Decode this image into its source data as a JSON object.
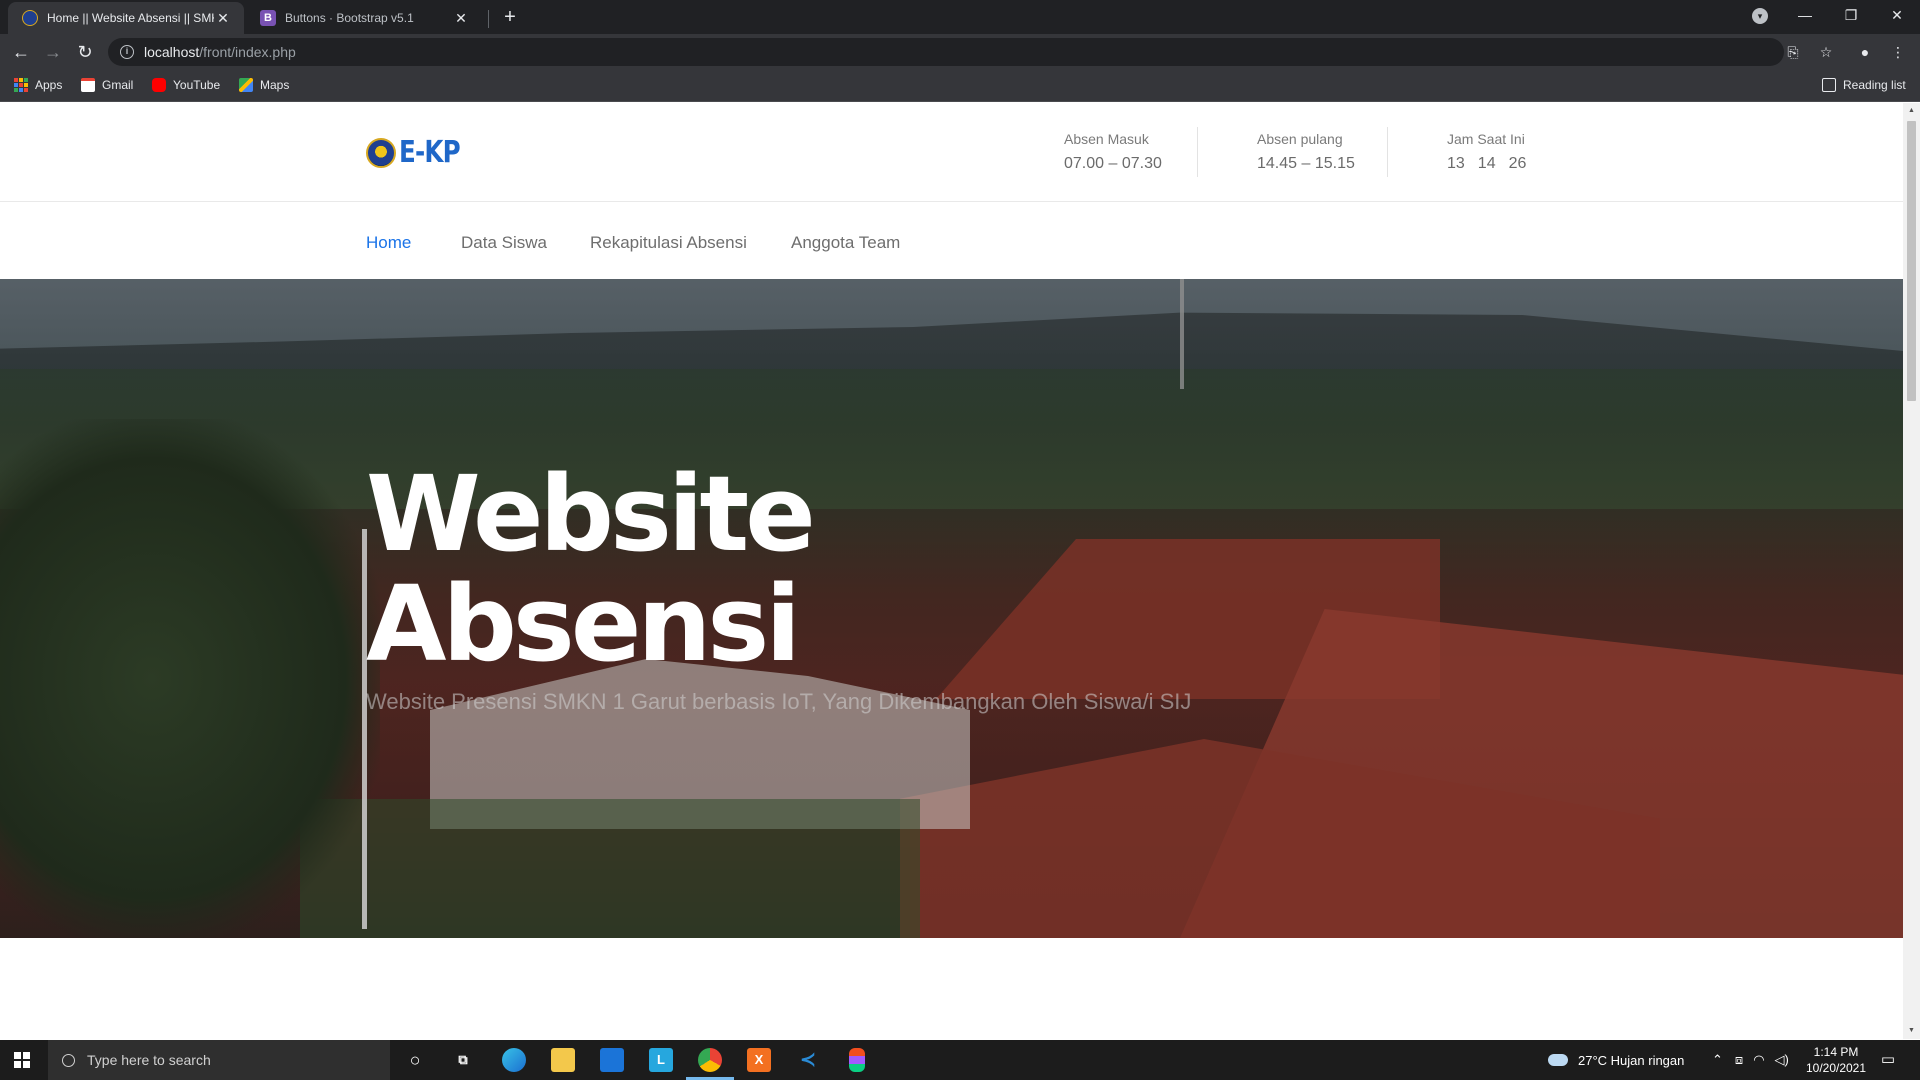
{
  "browser": {
    "tabs": [
      {
        "title": "Home || Website Absensi || SMKN",
        "favicon": "school-emblem-icon",
        "active": true
      },
      {
        "title": "Buttons · Bootstrap v5.1",
        "favicon": "B",
        "active": false
      }
    ],
    "new_tab": "+",
    "url_host": "localhost",
    "url_path": "/front/index.php",
    "bookmarks": [
      {
        "label": "Apps",
        "icon": "apps-grid-icon"
      },
      {
        "label": "Gmail",
        "icon": "gmail-icon"
      },
      {
        "label": "YouTube",
        "icon": "youtube-icon"
      },
      {
        "label": "Maps",
        "icon": "maps-icon"
      }
    ],
    "reading_list": "Reading list"
  },
  "site": {
    "logo_text": "E-KP",
    "absen_masuk": {
      "label": "Absen Masuk",
      "value": "07.00 – 07.30"
    },
    "absen_pulang": {
      "label": "Absen pulang",
      "value": "14.45 – 15.15"
    },
    "jam": {
      "label": "Jam Saat Ini",
      "hours": "13",
      "minutes": "14",
      "seconds": "26"
    },
    "nav": [
      {
        "label": "Home",
        "active": true
      },
      {
        "label": "Data Siswa",
        "active": false
      },
      {
        "label": "Rekapitulasi Absensi",
        "active": false
      },
      {
        "label": "Anggota Team",
        "active": false
      }
    ],
    "hero": {
      "title_line1": "Website",
      "title_line2": "Absensi",
      "subtitle": "Website Presensi SMKN 1 Garut berbasis IoT, Yang Dikembangkan Oleh Siswa/i SIJ"
    },
    "accent_color": "#1a73e8"
  },
  "taskbar": {
    "search_placeholder": "Type here to search",
    "weather": "27°C  Hujan ringan",
    "time": "1:14 PM",
    "date": "10/20/2021"
  }
}
